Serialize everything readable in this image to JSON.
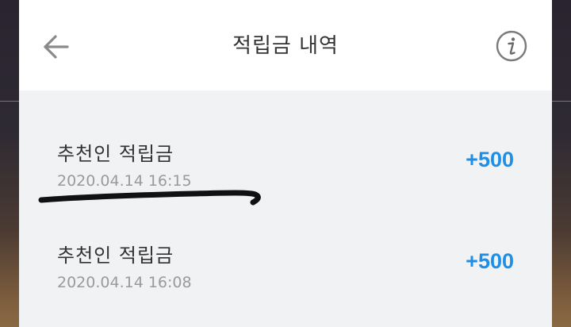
{
  "header": {
    "title": "적립금 내역",
    "back_icon": "arrow-left-icon",
    "info_icon": "info-circle-icon"
  },
  "items": [
    {
      "title": "추천인 적립금",
      "date": "2020.04.14 16:15",
      "amount": "+500"
    },
    {
      "title": "추천인 적립금",
      "date": "2020.04.14 16:08",
      "amount": "+500"
    }
  ],
  "colors": {
    "amount": "#1e8fe6",
    "panel_bg": "#f1f2f4",
    "header_bg": "#ffffff"
  }
}
